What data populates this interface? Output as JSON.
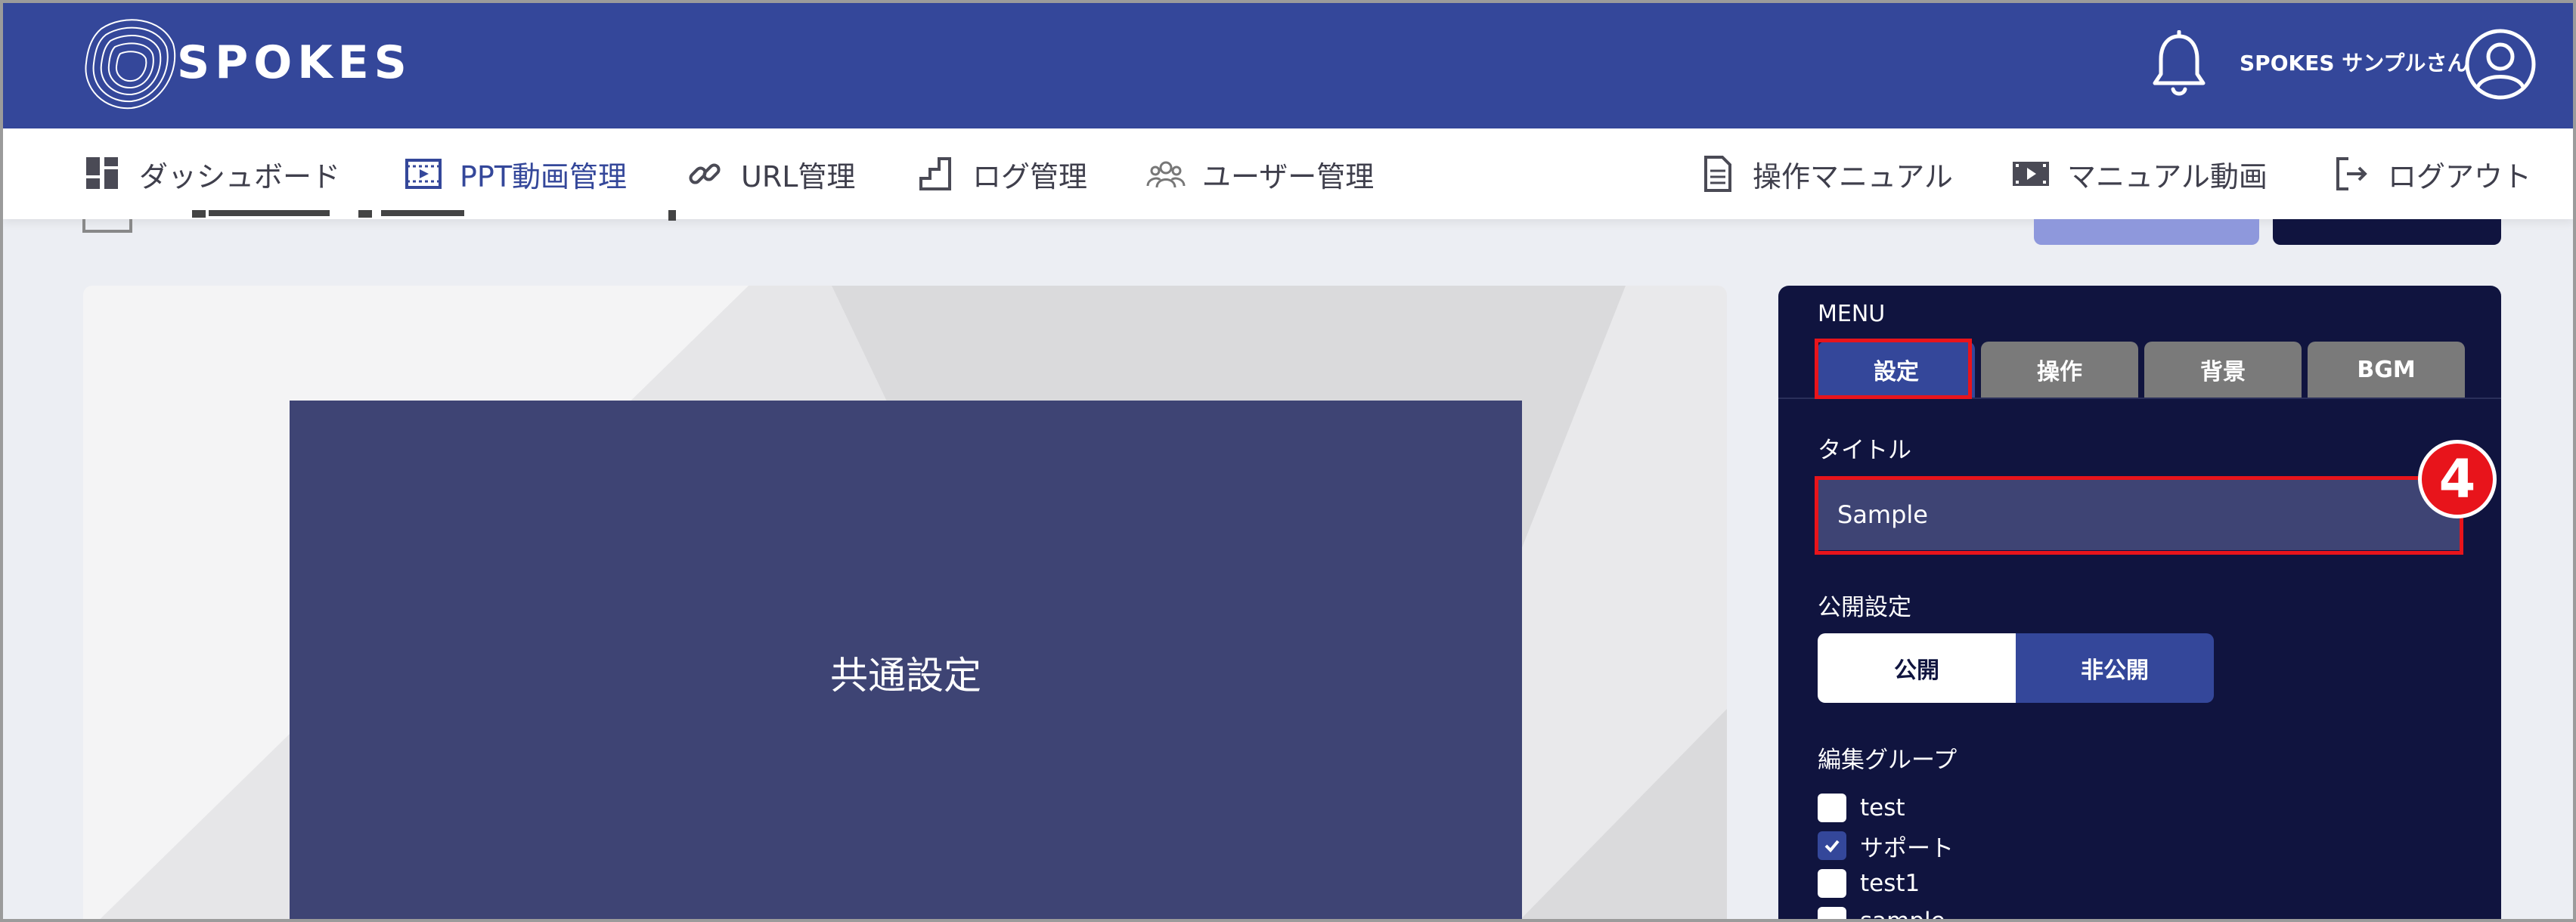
{
  "header": {
    "brand": "SPOKES",
    "user_name": "SPOKES サンプルさん"
  },
  "nav": {
    "left": [
      {
        "label": "ダッシュボード",
        "icon": "dashboard-icon",
        "active": false
      },
      {
        "label": "PPT動画管理",
        "icon": "film-icon",
        "active": true
      },
      {
        "label": "URL管理",
        "icon": "link-icon",
        "active": false
      },
      {
        "label": "ログ管理",
        "icon": "chart-steps-icon",
        "active": false
      },
      {
        "label": "ユーザー管理",
        "icon": "users-icon",
        "active": false
      }
    ],
    "right": [
      {
        "label": "操作マニュアル",
        "icon": "document-icon"
      },
      {
        "label": "マニュアル動画",
        "icon": "video-icon"
      },
      {
        "label": "ログアウト",
        "icon": "logout-icon"
      }
    ]
  },
  "preview": {
    "slide_text": "共通設定"
  },
  "panel": {
    "menu_label": "MENU",
    "tabs": [
      "設定",
      "操作",
      "背景",
      "BGM"
    ],
    "active_tab": "設定",
    "title_label": "タイトル",
    "title_value": "Sample",
    "step_badge": "4",
    "visibility_label": "公開設定",
    "visibility_public": "公開",
    "visibility_private": "非公開",
    "visibility_selected": "非公開",
    "group_label": "編集グループ",
    "groups": [
      {
        "name": "test",
        "checked": false
      },
      {
        "name": "サポート",
        "checked": true
      },
      {
        "name": "test1",
        "checked": false
      },
      {
        "name": "sample",
        "checked": false
      }
    ]
  },
  "colors": {
    "header_bg": "#34479a",
    "panel_bg": "#10143f",
    "highlight": "#e8141b",
    "slide_bg": "#3e4474"
  }
}
